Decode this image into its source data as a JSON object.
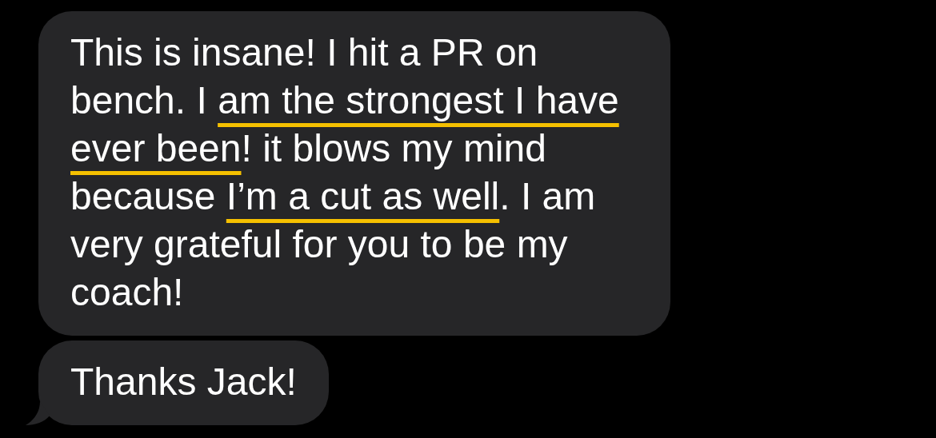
{
  "messages": [
    {
      "kind": "received",
      "tail": false,
      "segments": [
        {
          "text": "This is insane! I hit a PR on bench. I ",
          "underlined": false
        },
        {
          "text": "am the strongest I have ever been",
          "underlined": true
        },
        {
          "text": "! it blows my mind because ",
          "underlined": false
        },
        {
          "text": "I’m a cut as well",
          "underlined": true
        },
        {
          "text": ". I am very grateful for you to be my coach!",
          "underlined": false
        }
      ]
    },
    {
      "kind": "received",
      "tail": true,
      "segments": [
        {
          "text": "Thanks Jack!"
        }
      ]
    }
  ]
}
